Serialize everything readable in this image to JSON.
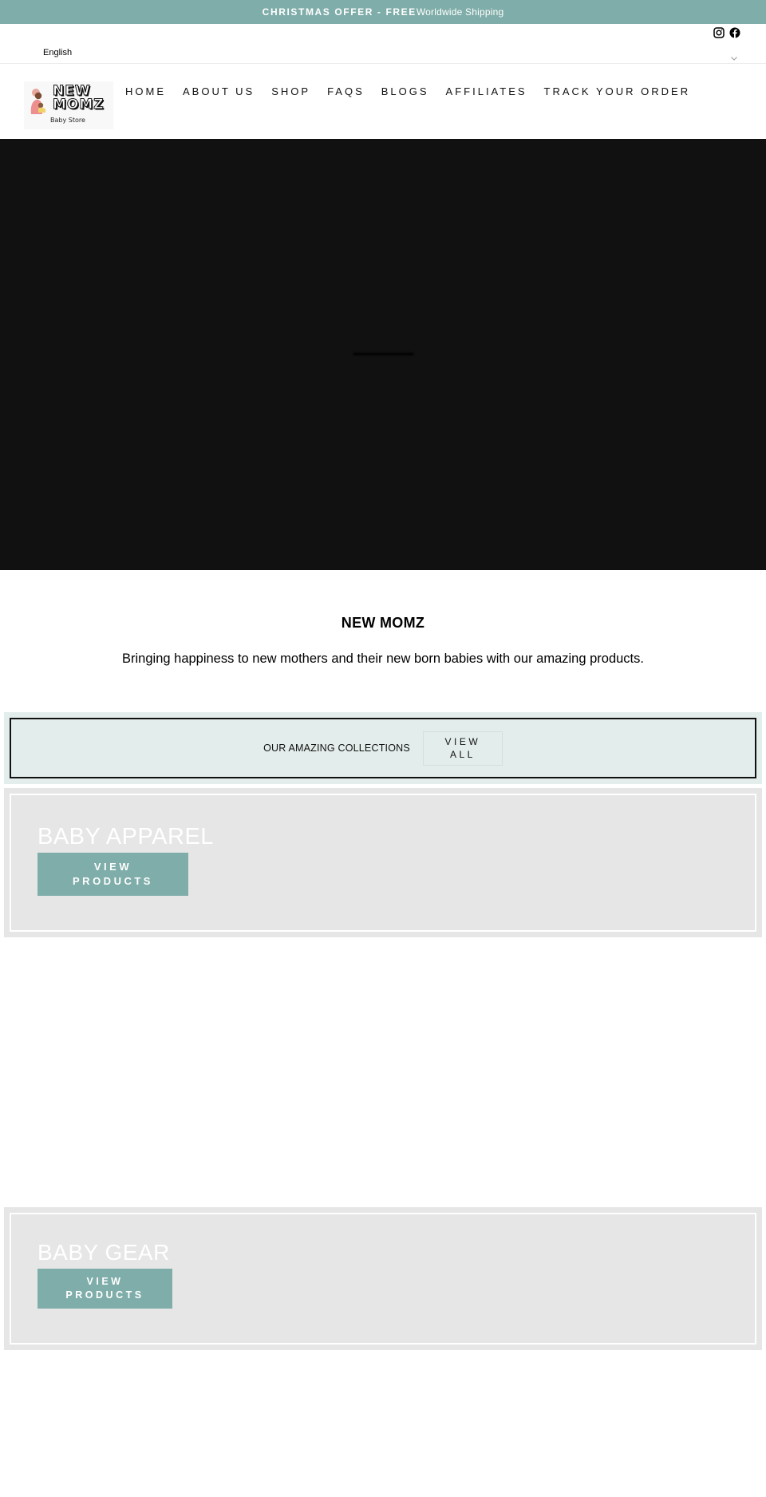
{
  "announcement": {
    "offer": "CHRISTMAS OFFER - FREE",
    "shipping": "Worldwide Shipping",
    "bg_color": "#7fada9"
  },
  "utility": {
    "language": "English",
    "social_icons": [
      "instagram-icon",
      "facebook-icon"
    ]
  },
  "header": {
    "logo_title_line1": "NEW",
    "logo_title_line2": "MOMZ",
    "logo_subtitle": "Baby Store",
    "nav": [
      {
        "label": "HOME"
      },
      {
        "label": "ABOUT US"
      },
      {
        "label": "SHOP"
      },
      {
        "label": "FAQS"
      },
      {
        "label": "BLOGS"
      },
      {
        "label": "AFFILIATES"
      },
      {
        "label": "TRACK YOUR ORDER"
      }
    ]
  },
  "intro": {
    "title": "NEW MOMZ",
    "text": "Bringing happiness to new mothers and their new born babies with our amazing products."
  },
  "collections": {
    "label": "OUR AMAZING COLLECTIONS",
    "view_all_line1": "VIEW",
    "view_all_line2": "ALL",
    "items": [
      {
        "title": "BABY APPAREL",
        "button_line1": "VIEW",
        "button_line2": "PRODUCTS"
      },
      {
        "title": "BABY GEAR",
        "button_line1": "VIEW",
        "button_line2": "PRODUCTS"
      }
    ]
  },
  "colors": {
    "accent": "#7fada9",
    "collections_bg": "#e3edeb",
    "card_bg": "#e6e6e6",
    "hero_bg": "#111111"
  }
}
